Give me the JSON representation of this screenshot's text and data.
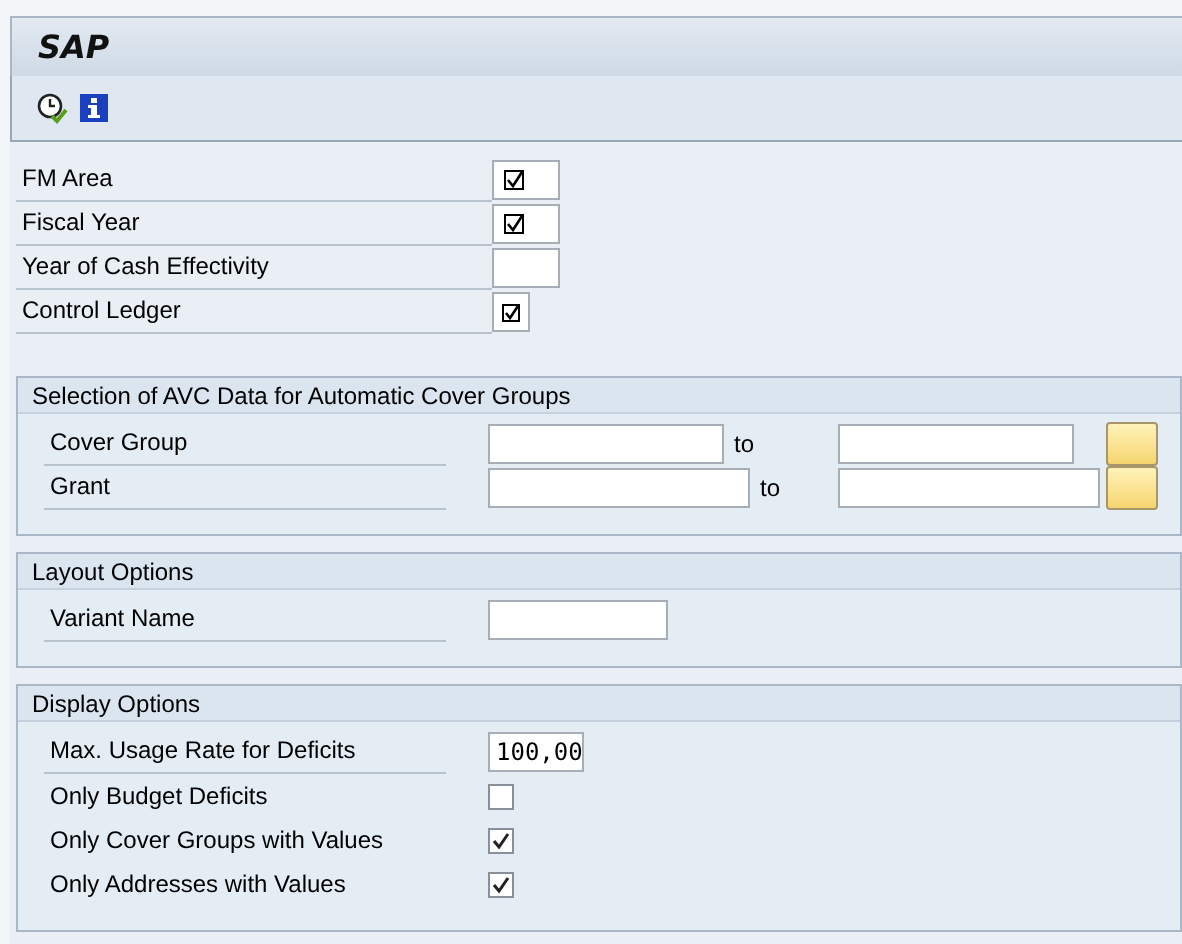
{
  "window": {
    "title": "SAP"
  },
  "toolbar": [
    {
      "kind": "clock"
    },
    {
      "kind": "info"
    }
  ],
  "fields": [
    {
      "label": "FM Area",
      "kind": "input",
      "required": true
    },
    {
      "label": "Fiscal Year",
      "kind": "input",
      "required": true
    },
    {
      "label": "Year of Cash Effectivity",
      "kind": "input",
      "required": false
    },
    {
      "label": "Control Ledger",
      "kind": "checkbox",
      "checked": true
    }
  ],
  "groups": [
    {
      "title": "Selection of AVC Data for Automatic Cover Groups",
      "rows": [
        {
          "kind": "range",
          "label": "Cover Group",
          "to_label": "to",
          "wide": false
        },
        {
          "kind": "range",
          "label": "Grant",
          "to_label": "to",
          "wide": true
        }
      ]
    },
    {
      "title": "Layout Options",
      "rows": [
        {
          "kind": "input",
          "label": "Variant Name"
        }
      ]
    },
    {
      "title": "Display Options",
      "rows": [
        {
          "kind": "input",
          "label": "Max. Usage Rate for Deficits",
          "value": "100,00"
        },
        {
          "kind": "checkbox",
          "label": "Only Budget Deficits",
          "checked": false
        },
        {
          "kind": "checkbox",
          "label": "Only Cover Groups with Values",
          "checked": true
        },
        {
          "kind": "checkbox",
          "label": "Only Addresses with Values",
          "checked": true
        }
      ]
    }
  ]
}
